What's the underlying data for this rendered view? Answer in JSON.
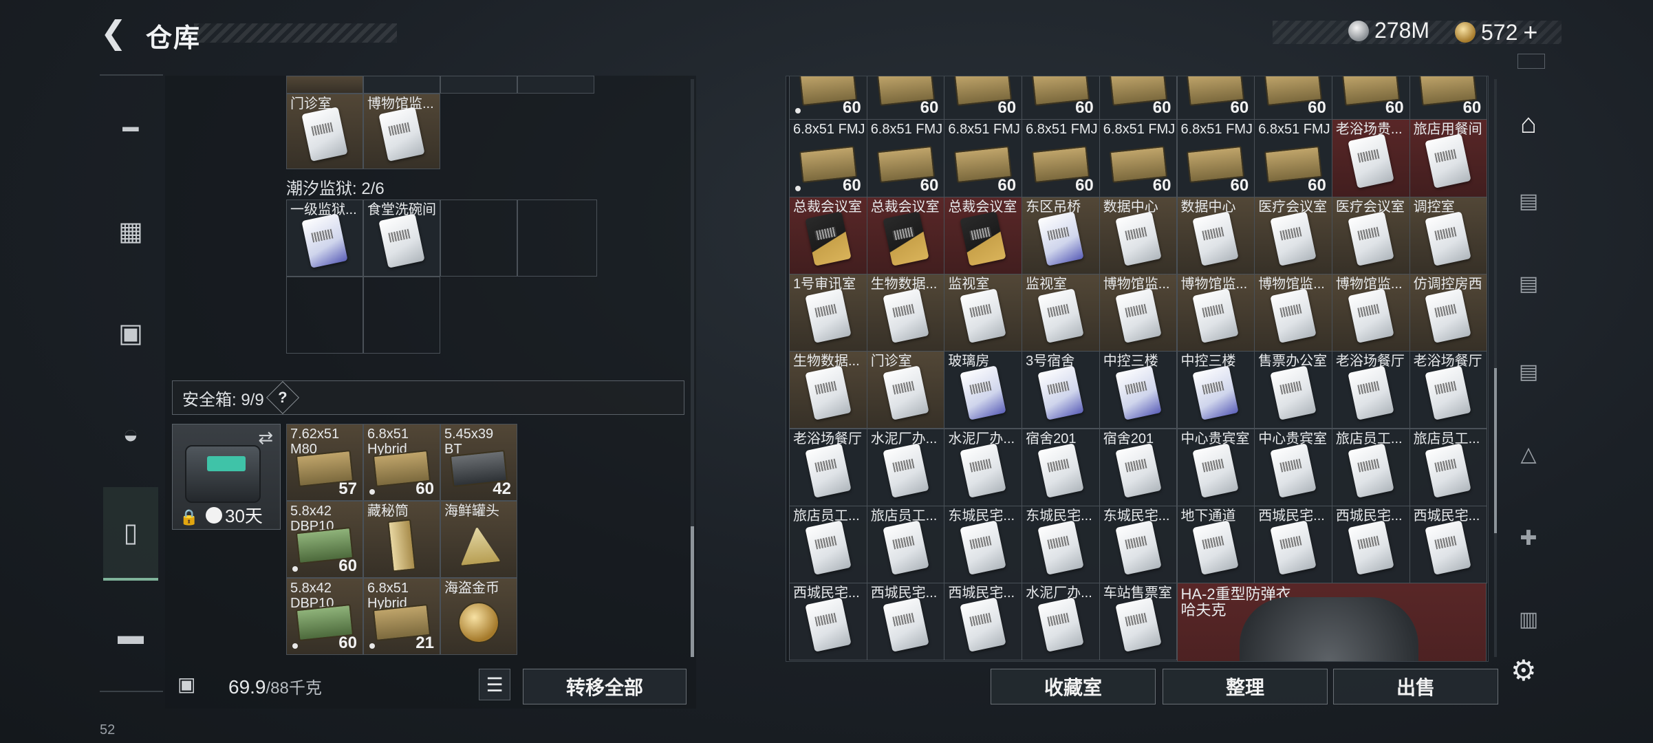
{
  "header": {
    "back_icon": "back-arrow-icon",
    "title": "仓库"
  },
  "currency": [
    {
      "icon": "silver-coin-icon",
      "value": "278M"
    },
    {
      "icon": "gold-coin-icon",
      "value": "572",
      "plus": "+"
    }
  ],
  "nav": [
    "gun-icon",
    "vest-icon",
    "backpack-icon",
    "bag-icon",
    "case-icon",
    "toolbox-icon"
  ],
  "left": {
    "top_labels": [
      "门诊室",
      "博物馆监..."
    ],
    "prison_label": "潮汐监狱: 2/6",
    "prison_items": [
      "一级监狱...",
      "食堂洗碗间"
    ],
    "safe_label": "安全箱: 9/9",
    "safe_help": "?",
    "safe_days": "30天",
    "safe_items": [
      {
        "label": "7.62x51\nM80",
        "count": "57",
        "kind": "ammo"
      },
      {
        "label": "6.8x51\nHybrid",
        "count": "60",
        "kind": "ammo",
        "dot": true
      },
      {
        "label": "5.45x39\nBT",
        "count": "42",
        "kind": "ammo-dark"
      },
      {
        "label": "5.8x42\nDBP10",
        "count": "60",
        "kind": "ammo-green",
        "dot": true
      },
      {
        "label": "藏秘筒",
        "count": "",
        "kind": "tube"
      },
      {
        "label": "海鲜罐头",
        "count": "",
        "kind": "can"
      },
      {
        "label": "5.8x42\nDBP10",
        "count": "60",
        "kind": "ammo-green",
        "dot": true
      },
      {
        "label": "6.8x51\nHybrid",
        "count": "21",
        "kind": "ammo",
        "dot": true
      },
      {
        "label": "海盗金币",
        "count": "",
        "kind": "coin"
      }
    ],
    "weight": "69.9",
    "weight_max": "/88千克",
    "transfer_all": "转移全部"
  },
  "grid": [
    [
      {
        "l": "",
        "c": "60",
        "t": "ammo",
        "b": "dark",
        "d": true
      },
      {
        "l": "",
        "c": "60",
        "t": "ammo",
        "b": "dark"
      },
      {
        "l": "",
        "c": "60",
        "t": "ammo",
        "b": "dark"
      },
      {
        "l": "",
        "c": "60",
        "t": "ammo",
        "b": "dark"
      },
      {
        "l": "",
        "c": "60",
        "t": "ammo",
        "b": "dark"
      },
      {
        "l": "",
        "c": "60",
        "t": "ammo",
        "b": "dark"
      },
      {
        "l": "",
        "c": "60",
        "t": "ammo",
        "b": "dark"
      },
      {
        "l": "",
        "c": "60",
        "t": "ammo",
        "b": "dark"
      },
      {
        "l": "",
        "c": "60",
        "t": "ammo",
        "b": "dark"
      }
    ],
    [
      {
        "l": "6.8x51 FMJ",
        "c": "60",
        "t": "ammo",
        "b": "dark",
        "d": true
      },
      {
        "l": "6.8x51 FMJ",
        "c": "60",
        "t": "ammo",
        "b": "dark"
      },
      {
        "l": "6.8x51 FMJ",
        "c": "60",
        "t": "ammo",
        "b": "dark"
      },
      {
        "l": "6.8x51 FMJ",
        "c": "60",
        "t": "ammo",
        "b": "dark"
      },
      {
        "l": "6.8x51 FMJ",
        "c": "60",
        "t": "ammo",
        "b": "dark"
      },
      {
        "l": "6.8x51 FMJ",
        "c": "60",
        "t": "ammo",
        "b": "dark"
      },
      {
        "l": "6.8x51 FMJ",
        "c": "60",
        "t": "ammo",
        "b": "dark"
      },
      {
        "l": "老浴场贵...",
        "c": "",
        "t": "card",
        "b": "red"
      },
      {
        "l": "旅店用餐间",
        "c": "",
        "t": "card",
        "b": "red"
      }
    ],
    [
      {
        "l": "总裁会议室",
        "c": "",
        "t": "card-gold",
        "b": "red"
      },
      {
        "l": "总裁会议室",
        "c": "",
        "t": "card-gold",
        "b": "red"
      },
      {
        "l": "总裁会议室",
        "c": "",
        "t": "card-gold",
        "b": "red"
      },
      {
        "l": "东区吊桥",
        "c": "",
        "t": "card-purple",
        "b": "brown"
      },
      {
        "l": "数据中心",
        "c": "",
        "t": "card",
        "b": "brown"
      },
      {
        "l": "数据中心",
        "c": "",
        "t": "card",
        "b": "brown"
      },
      {
        "l": "医疗会议室",
        "c": "",
        "t": "card",
        "b": "brown"
      },
      {
        "l": "医疗会议室",
        "c": "",
        "t": "card",
        "b": "brown"
      },
      {
        "l": "调控室",
        "c": "",
        "t": "card",
        "b": "brown"
      }
    ],
    [
      {
        "l": "1号审讯室",
        "c": "",
        "t": "card",
        "b": "brown"
      },
      {
        "l": "生物数据...",
        "c": "",
        "t": "card",
        "b": "brown"
      },
      {
        "l": "监视室",
        "c": "",
        "t": "card",
        "b": "brown"
      },
      {
        "l": "监视室",
        "c": "",
        "t": "card",
        "b": "brown"
      },
      {
        "l": "博物馆监...",
        "c": "",
        "t": "card",
        "b": "brown"
      },
      {
        "l": "博物馆监...",
        "c": "",
        "t": "card",
        "b": "brown"
      },
      {
        "l": "博物馆监...",
        "c": "",
        "t": "card",
        "b": "brown"
      },
      {
        "l": "博物馆监...",
        "c": "",
        "t": "card",
        "b": "brown"
      },
      {
        "l": "仿调控房西",
        "c": "",
        "t": "card",
        "b": "brown"
      }
    ],
    [
      {
        "l": "生物数据...",
        "c": "",
        "t": "card",
        "b": "brown"
      },
      {
        "l": "门诊室",
        "c": "",
        "t": "card",
        "b": "brown"
      },
      {
        "l": "玻璃房",
        "c": "",
        "t": "card-purple",
        "b": "dark"
      },
      {
        "l": "3号宿舍",
        "c": "",
        "t": "card-purple",
        "b": "dark"
      },
      {
        "l": "中控三楼",
        "c": "",
        "t": "card-purple",
        "b": "dark"
      },
      {
        "l": "中控三楼",
        "c": "",
        "t": "card-purple",
        "b": "dark"
      },
      {
        "l": "售票办公室",
        "c": "",
        "t": "card",
        "b": "dark"
      },
      {
        "l": "老浴场餐厅",
        "c": "",
        "t": "card",
        "b": "dark"
      },
      {
        "l": "老浴场餐厅",
        "c": "",
        "t": "card",
        "b": "dark"
      }
    ],
    [
      {
        "l": "老浴场餐厅",
        "c": "",
        "t": "card",
        "b": "dark"
      },
      {
        "l": "水泥厂办...",
        "c": "",
        "t": "card",
        "b": "dark"
      },
      {
        "l": "水泥厂办...",
        "c": "",
        "t": "card",
        "b": "dark"
      },
      {
        "l": "宿舍201",
        "c": "",
        "t": "card",
        "b": "dark"
      },
      {
        "l": "宿舍201",
        "c": "",
        "t": "card",
        "b": "dark"
      },
      {
        "l": "中心贵宾室",
        "c": "",
        "t": "card",
        "b": "dark"
      },
      {
        "l": "中心贵宾室",
        "c": "",
        "t": "card",
        "b": "dark"
      },
      {
        "l": "旅店员工...",
        "c": "",
        "t": "card",
        "b": "dark"
      },
      {
        "l": "旅店员工...",
        "c": "",
        "t": "card",
        "b": "dark"
      }
    ],
    [
      {
        "l": "旅店员工...",
        "c": "",
        "t": "card",
        "b": "dark"
      },
      {
        "l": "旅店员工...",
        "c": "",
        "t": "card",
        "b": "dark"
      },
      {
        "l": "东城民宅...",
        "c": "",
        "t": "card",
        "b": "dark"
      },
      {
        "l": "东城民宅...",
        "c": "",
        "t": "card",
        "b": "dark"
      },
      {
        "l": "东城民宅...",
        "c": "",
        "t": "card",
        "b": "dark"
      },
      {
        "l": "地下通道",
        "c": "",
        "t": "card",
        "b": "dark"
      },
      {
        "l": "西城民宅...",
        "c": "",
        "t": "card",
        "b": "dark"
      },
      {
        "l": "西城民宅...",
        "c": "",
        "t": "card",
        "b": "dark"
      },
      {
        "l": "西城民宅...",
        "c": "",
        "t": "card",
        "b": "dark"
      }
    ],
    [
      {
        "l": "西城民宅...",
        "c": "",
        "t": "card",
        "b": "dark"
      },
      {
        "l": "西城民宅...",
        "c": "",
        "t": "card",
        "b": "dark"
      },
      {
        "l": "西城民宅...",
        "c": "",
        "t": "card",
        "b": "dark"
      },
      {
        "l": "水泥厂办...",
        "c": "",
        "t": "card",
        "b": "dark"
      },
      {
        "l": "车站售票室",
        "c": "",
        "t": "card",
        "b": "dark"
      }
    ]
  ],
  "armor": {
    "name": "HA-2重型防弹衣",
    "sub": "哈夫克"
  },
  "bottom_buttons": [
    "收藏室",
    "整理",
    "出售"
  ],
  "right_icons": [
    "home-icon",
    "weapon-rack-icon-1",
    "weapon-rack-icon-2",
    "weapon-rack-icon-3",
    "weapon-rack-icon-4",
    "medical-rack-icon",
    "storage-rack-icon"
  ],
  "status": "52"
}
